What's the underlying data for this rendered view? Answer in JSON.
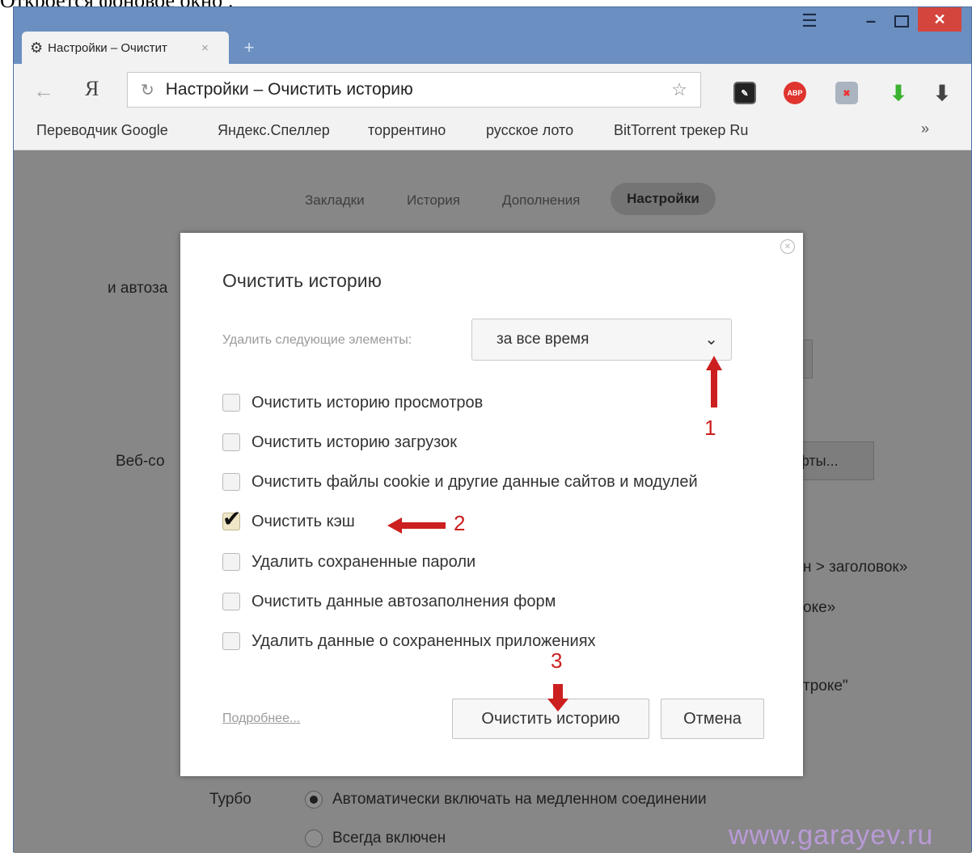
{
  "caption": "Откроется фоновое окно :",
  "window_controls": {
    "menu": "☰",
    "minimize": "–",
    "close": "✕"
  },
  "tab": {
    "title": "Настройки – Очистит",
    "close": "×",
    "new_tab": "+"
  },
  "toolbar": {
    "back": "←",
    "yandex": "Я",
    "address": "Настройки – Очистить историю",
    "reload": "↻",
    "star": "☆",
    "ext_abp": "ABP",
    "download": "⬇"
  },
  "bookmarks": {
    "items": [
      "Переводчик Google",
      "Яндекс.Спеллер",
      "торрентино",
      "русское лото",
      "BitTorrent трекер Ru"
    ],
    "more": "»"
  },
  "settings_nav": {
    "tabs": [
      "Закладки",
      "История",
      "Дополнения",
      "Настройки"
    ],
    "active": "Настройки"
  },
  "background": {
    "autofill_partial": "и автоза",
    "web_content_partial": "Веб-со",
    "fonts_button_partial": "фты...",
    "header_partial": "н > заголовок»",
    "line_partial": "оке»",
    "string_partial": "троке\"",
    "turbo_label": "Турбо",
    "turbo_option_auto": "Автоматически включать на медленном соединении",
    "turbo_option_always": "Всегда включен"
  },
  "dialog": {
    "title": "Очистить историю",
    "delete_label": "Удалить следующие элементы:",
    "period_value": "за все время",
    "options": [
      {
        "label": "Очистить историю просмотров",
        "checked": false
      },
      {
        "label": "Очистить историю загрузок",
        "checked": false
      },
      {
        "label": "Очистить файлы cookie и другие данные сайтов и модулей",
        "checked": false
      },
      {
        "label": "Очистить кэш",
        "checked": true
      },
      {
        "label": "Удалить сохраненные пароли",
        "checked": false
      },
      {
        "label": "Очистить данные автозаполнения форм",
        "checked": false
      },
      {
        "label": "Удалить данные о сохраненных приложениях",
        "checked": false
      }
    ],
    "more_link": "Подробнее...",
    "clear_button": "Очистить историю",
    "cancel_button": "Отмена"
  },
  "annotations": {
    "step1": "1",
    "step2": "2",
    "step3": "3",
    "color": "#cc1f1f"
  },
  "watermark": "www.garayev.ru"
}
